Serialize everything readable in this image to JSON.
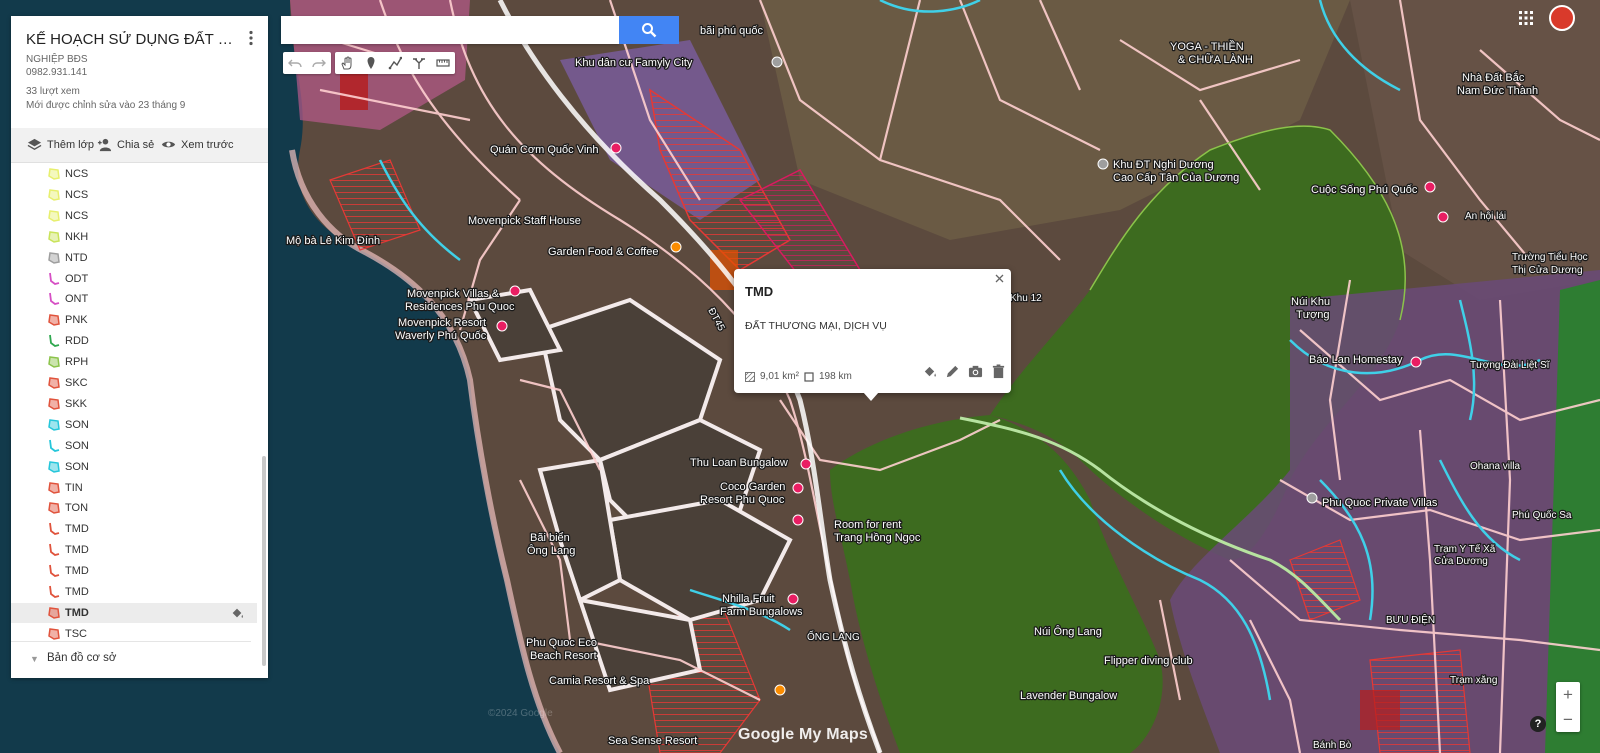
{
  "panel": {
    "title": "KẾ HOẠCH SỬ DỤNG ĐẤT PHÚ QUỐC",
    "author": "NGHIỆP BĐS",
    "phone": "0982.931.141",
    "views": "33 lượt xem",
    "edited": "Mới được chỉnh sửa vào 23 tháng 9",
    "add_layer": "Thêm lớp",
    "share": "Chia sẻ",
    "preview": "Xem trước",
    "basemap": "Bản đồ cơ sở",
    "layers": [
      {
        "name": "NCS",
        "icon": "polygon-icon",
        "color": "#e7ef6e"
      },
      {
        "name": "NCS",
        "icon": "polygon-icon",
        "color": "#e7ef6e"
      },
      {
        "name": "NCS",
        "icon": "polygon-icon",
        "color": "#e7ef6e"
      },
      {
        "name": "NKH",
        "icon": "polygon-icon",
        "color": "#c9e35a"
      },
      {
        "name": "NTD",
        "icon": "polygon-icon",
        "color": "#9e9e9e"
      },
      {
        "name": "ODT",
        "icon": "line-icon",
        "color": "#d64fc4"
      },
      {
        "name": "ONT",
        "icon": "line-icon",
        "color": "#d64fc4"
      },
      {
        "name": "PNK",
        "icon": "polygon-icon",
        "color": "#e0533c"
      },
      {
        "name": "RDD",
        "icon": "line-icon",
        "color": "#2fa84f"
      },
      {
        "name": "RPH",
        "icon": "polygon-icon",
        "color": "#8bc34a"
      },
      {
        "name": "SKC",
        "icon": "polygon-icon",
        "color": "#e0533c"
      },
      {
        "name": "SKK",
        "icon": "polygon-icon",
        "color": "#e0533c"
      },
      {
        "name": "SON",
        "icon": "polygon-icon",
        "color": "#25c6da"
      },
      {
        "name": "SON",
        "icon": "line-icon",
        "color": "#25c6da"
      },
      {
        "name": "SON",
        "icon": "polygon-icon",
        "color": "#25c6da"
      },
      {
        "name": "TIN",
        "icon": "polygon-icon",
        "color": "#e0533c"
      },
      {
        "name": "TON",
        "icon": "polygon-icon",
        "color": "#e0533c"
      },
      {
        "name": "TMD",
        "icon": "line-icon",
        "color": "#e0533c"
      },
      {
        "name": "TMD",
        "icon": "line-icon",
        "color": "#e0533c"
      },
      {
        "name": "TMD",
        "icon": "line-icon",
        "color": "#e0533c"
      },
      {
        "name": "TMD",
        "icon": "line-icon",
        "color": "#e0533c"
      },
      {
        "name": "TMD",
        "icon": "polygon-icon",
        "color": "#e0533c",
        "selected": true
      },
      {
        "name": "TSC",
        "icon": "polygon-icon",
        "color": "#e0533c"
      }
    ]
  },
  "search": {
    "value": "",
    "placeholder": ""
  },
  "popup": {
    "title": "TMD",
    "description": "ĐẤT THƯƠNG MẠI, DỊCH VỤ",
    "area": "9,01 km²",
    "perimeter": "198 km"
  },
  "map_labels": [
    {
      "text": "Quán Cơm Quốc Vinh"
    },
    {
      "text": "Movenpick Staff House"
    },
    {
      "text": "Garden Food & Coffee"
    },
    {
      "text": "Mộ bà Lê Kim Đính"
    },
    {
      "text": "Movenpick Villas &"
    },
    {
      "text": "Residences Phu Quoc"
    },
    {
      "text": "Movenpick Resort"
    },
    {
      "text": "Waverly Phú Quốc"
    },
    {
      "text": "Khu dân cư Famyly City"
    },
    {
      "text": "bãi phú quốc"
    },
    {
      "text": "Khu ĐT Nghi Dương"
    },
    {
      "text": "Cao Cấp Tân Của Dương"
    },
    {
      "text": "Cuộc Sống Phú Quốc"
    },
    {
      "text": "Núi Khu"
    },
    {
      "text": "Tượng"
    },
    {
      "text": "Báo Lan Homestay"
    },
    {
      "text": "Thu Loan Bungalow"
    },
    {
      "text": "Coco Garden"
    },
    {
      "text": "Resort Phu Quoc"
    },
    {
      "text": "Room for rent"
    },
    {
      "text": "Trang Hồng Ngọc"
    },
    {
      "text": "Bãi biển"
    },
    {
      "text": "Ông Lang"
    },
    {
      "text": "Nhilla Fruit"
    },
    {
      "text": "Farm Bungalows"
    },
    {
      "text": "Phu Quoc Eco"
    },
    {
      "text": "Beach Resort"
    },
    {
      "text": "Camia Resort & Spa"
    },
    {
      "text": "Núi Ông Lang"
    },
    {
      "text": "Flipper diving club"
    },
    {
      "text": "Lavender Bungalow"
    },
    {
      "text": "Phu Quoc Private Villas"
    },
    {
      "text": "Sea Sense Resort"
    },
    {
      "text": "YOGA - THIỀN"
    },
    {
      "text": "& CHỮA LÀNH"
    },
    {
      "text": "Nhà Đất Bắc"
    },
    {
      "text": "Nam Đức Thành"
    },
    {
      "text": "Trạm Y Tế Xã"
    },
    {
      "text": "Cửa Dương"
    },
    {
      "text": "BƯU ĐIỆN"
    },
    {
      "text": "Trạm xăng"
    },
    {
      "text": "Phú Quốc Sa"
    },
    {
      "text": "Bánh Bò"
    },
    {
      "text": "Khu 12"
    },
    {
      "text": "ĐT45"
    },
    {
      "text": "ỐNG LANG"
    },
    {
      "text": "An hội lái"
    },
    {
      "text": "Trường Tiểu Học"
    },
    {
      "text": "Thị Cửa Dương"
    },
    {
      "text": "Tượng Đài Liệt Sĩ"
    },
    {
      "text": "Ohana villa"
    }
  ],
  "google_logo": "Google My Maps",
  "watermark": "©2024 Google",
  "colors": {
    "accent": "#4285f4",
    "forest": "#3d6b1f",
    "sea": "#1a4a5f",
    "land_red": "#c62828",
    "road": "#ffd9d9"
  }
}
